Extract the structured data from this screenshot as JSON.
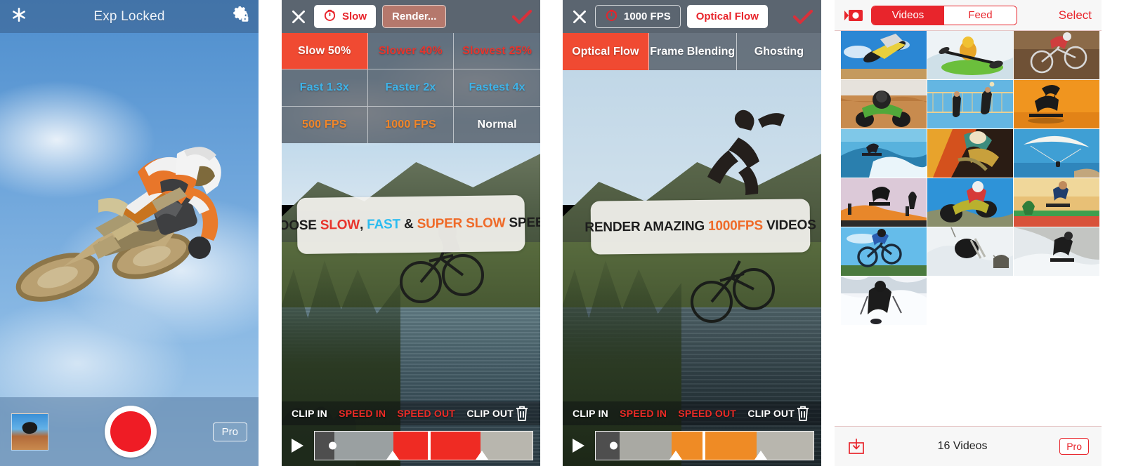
{
  "panels": {
    "camera": {
      "header": {
        "title": "Exp Locked",
        "left_icon": "flash-star-icon",
        "right_icon": "gear-lock-icon"
      },
      "footer": {
        "thumbnail": "last-capture-thumbnail",
        "record": "record-button",
        "pro_label": "Pro"
      }
    },
    "speed_editor": {
      "topbar": {
        "close_icon": "close-icon",
        "mode_icon": "stopwatch-icon",
        "mode_label": "Slow",
        "render_label": "Render...",
        "confirm_icon": "check-icon"
      },
      "speed_grid": [
        {
          "label": "Slow 50%",
          "color": "#ffffff",
          "selected": true
        },
        {
          "label": "Slower 40%",
          "color": "#e8342c",
          "selected": false
        },
        {
          "label": "Slowest 25%",
          "color": "#e8342c",
          "selected": false
        },
        {
          "label": "Fast 1.3x",
          "color": "#3fb3e8",
          "selected": false
        },
        {
          "label": "Faster 2x",
          "color": "#3fb3e8",
          "selected": false
        },
        {
          "label": "Fastest 4x",
          "color": "#3fb3e8",
          "selected": false
        },
        {
          "label": "500 FPS",
          "color": "#f0862a",
          "selected": false
        },
        {
          "label": "1000 FPS",
          "color": "#f0862a",
          "selected": false
        },
        {
          "label": "Normal",
          "color": "#ffffff",
          "selected": false
        }
      ],
      "caption": {
        "part1": "CHOOSE ",
        "highlight1": "SLOW",
        "part2": ", ",
        "highlight2": "FAST",
        "part3": " & ",
        "highlight3": "SUPER SLOW",
        "part4": " SPEEDS"
      },
      "timeline_labels": {
        "clip_in": "CLIP IN",
        "speed_in": "SPEED IN",
        "speed_out": "SPEED OUT",
        "clip_out": "CLIP OUT",
        "delete_icon": "trash-icon",
        "play_icon": "play-icon"
      },
      "timeline_accent": "#ef2b23"
    },
    "flow_editor": {
      "topbar": {
        "close_icon": "close-icon",
        "mode_icon": "stopwatch-icon",
        "mode_label": "1000 FPS",
        "render_label": "Optical Flow",
        "confirm_icon": "check-icon"
      },
      "tabs": [
        {
          "label": "Optical Flow",
          "selected": true
        },
        {
          "label": "Frame Blending",
          "selected": false
        },
        {
          "label": "Ghosting",
          "selected": false
        }
      ],
      "caption": {
        "part1": "RENDER AMAZING ",
        "highlight1": "1000FPS",
        "part2": " VIDEOS"
      },
      "timeline_labels": {
        "clip_in": "CLIP IN",
        "speed_in": "SPEED IN",
        "speed_out": "SPEED OUT",
        "clip_out": "CLIP OUT",
        "delete_icon": "trash-icon",
        "play_icon": "play-icon"
      },
      "timeline_accent": "#ef8b25"
    },
    "library": {
      "header": {
        "camera_icon": "video-camera-icon",
        "tabs": [
          {
            "label": "Videos",
            "selected": true
          },
          {
            "label": "Feed",
            "selected": false
          }
        ],
        "select_label": "Select"
      },
      "grid": [
        {
          "name": "motocross-jump"
        },
        {
          "name": "kayak-whitewater"
        },
        {
          "name": "downhill-bike"
        },
        {
          "name": "atv-dune"
        },
        {
          "name": "beach-volleyball"
        },
        {
          "name": "kitesurf-sunset"
        },
        {
          "name": "surfing-wave"
        },
        {
          "name": "wakeboard-sunset"
        },
        {
          "name": "paraglider-coast"
        },
        {
          "name": "skate-ramp"
        },
        {
          "name": "dirtbike-turn"
        },
        {
          "name": "skate-beach"
        },
        {
          "name": "bmx-air"
        },
        {
          "name": "ski-powder-jump"
        },
        {
          "name": "snowboard-slope"
        },
        {
          "name": "skier-deep-snow"
        }
      ],
      "footer": {
        "import_icon": "import-icon",
        "count_label": "16 Videos",
        "pro_label": "Pro"
      }
    }
  },
  "colors": {
    "accent_red": "#e8252c",
    "accent_orange": "#ef8b25",
    "accent_blue": "#3fb3e8",
    "selected_cell": "#f04a32"
  }
}
